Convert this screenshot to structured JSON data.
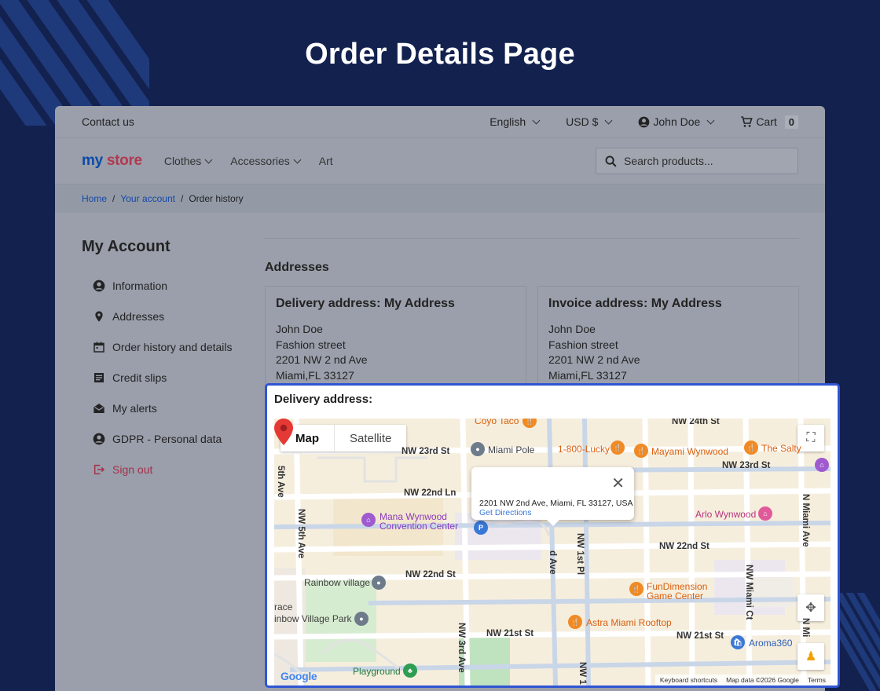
{
  "page_heading": "Order Details Page",
  "topbar": {
    "contact": "Contact us",
    "language": "English",
    "currency": "USD $",
    "user": "John Doe",
    "cart_label": "Cart",
    "cart_count": "0"
  },
  "navbar": {
    "logo_my": "my",
    "logo_store": "store",
    "menu": [
      {
        "label": "Clothes"
      },
      {
        "label": "Accessories"
      },
      {
        "label": "Art"
      }
    ],
    "search_placeholder": "Search products..."
  },
  "breadcrumb": {
    "items": [
      "Home",
      "Your account",
      "Order history"
    ]
  },
  "sidebar": {
    "title": "My Account",
    "items": [
      {
        "label": "Information",
        "icon": "user-circle-icon"
      },
      {
        "label": "Addresses",
        "icon": "location-pin-icon"
      },
      {
        "label": "Order history and details",
        "icon": "calendar-icon"
      },
      {
        "label": "Credit slips",
        "icon": "receipt-icon"
      },
      {
        "label": "My alerts",
        "icon": "mail-open-icon"
      },
      {
        "label": "GDPR - Personal data",
        "icon": "user-circle-icon"
      },
      {
        "label": "Sign out",
        "icon": "sign-out-icon"
      }
    ]
  },
  "content": {
    "heading": "Addresses",
    "delivery": {
      "title": "Delivery address: My Address",
      "lines": [
        "John Doe",
        "Fashion street",
        "2201 NW 2 nd Ave",
        "Miami,FL 33127"
      ]
    },
    "invoice": {
      "title": "Invoice address: My Address",
      "lines": [
        "John Doe",
        "Fashion street",
        "2201 NW 2 nd Ave",
        "Miami,FL 33127"
      ]
    }
  },
  "map_panel": {
    "title": "Delivery address:",
    "map_type": {
      "map": "Map",
      "satellite": "Satellite"
    },
    "info_window": {
      "address": "2201 NW 2nd Ave, Miami, FL 33127, USA",
      "directions": "Get Directions"
    },
    "streets": {
      "nw24": "NW 24th St",
      "nw23_left": "NW 23rd St",
      "nw23_right": "NW 23rd St",
      "nw22ln": "NW 22nd Ln",
      "nw22_right": "NW 22nd St",
      "nw22_left": "NW 22nd St",
      "nw21_left": "NW 21st St",
      "nw21_right": "NW 21st St",
      "nw5_top": "5th Ave",
      "nw5": "NW 5th Ave",
      "nw3": "NW 3rd Ave",
      "nd_ave": "d Ave",
      "nw1pl": "NW 1st Pl",
      "nwmiami_ct": "NW Miami Ct",
      "nmiami_ave": "N Miami Ave",
      "nw1_bottom": "NW 1",
      "nmiami_bottom": "N Mi"
    },
    "places": {
      "coyo": "Coyo Taco",
      "lucky": "1-800-Lucky",
      "mayami": "Mayami Wynwood",
      "salty": "The Salty",
      "miami_pole": "Miami Pole",
      "mana1": "Mana Wynwood",
      "mana2": "Convention Center",
      "arlo": "Arlo Wynwood",
      "rainbow": "Rainbow village",
      "race": "race",
      "rainbow_park": "inbow Village Park",
      "fun1": "FunDimension",
      "fun2": "Game Center",
      "astra": "Astra Miami Rooftop",
      "aroma": "Aroma360",
      "playground": "Playground"
    },
    "google": "Google",
    "footer": {
      "shortcuts": "Keyboard shortcuts",
      "data": "Map data ©2026 Google",
      "terms": "Terms"
    }
  },
  "colors": {
    "background": "#13214f",
    "panel_border": "#2f55d4",
    "link": "#1448a8",
    "signout": "#a4304a"
  }
}
